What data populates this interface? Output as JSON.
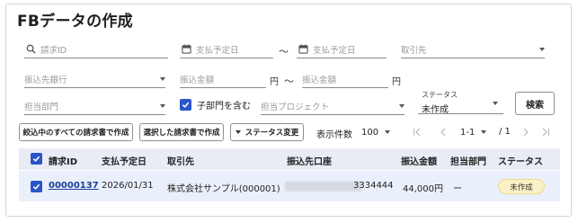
{
  "page_title": "FBデータの作成",
  "filters": {
    "invoice_id_placeholder": "請求ID",
    "pay_date_from_placeholder": "支払予定日",
    "range_sep": "〜",
    "pay_date_to_placeholder": "支払予定日",
    "client_placeholder": "取引先",
    "bank_placeholder": "振込先銀行",
    "amount_from_placeholder": "振込金額",
    "amount_unit": "円",
    "amount_to_placeholder": "振込金額",
    "dept_placeholder": "担当部門",
    "include_sub_label": "子部門を含む",
    "project_placeholder": "担当プロジェクト",
    "status_label": "ステータス",
    "status_value": "未作成",
    "search_button": "検索"
  },
  "actions": {
    "create_all": "絞込中のすべての請求書で作成",
    "create_selected": "選択した請求書で作成",
    "change_status": "ステータス変更"
  },
  "pager": {
    "per_page_label": "表示件数",
    "per_page_value": "100",
    "range_value": "1-1",
    "total": "/ 1"
  },
  "table": {
    "headers": {
      "invoice_id": "請求ID",
      "pay_date": "支払予定日",
      "client": "取引先",
      "account": "振込先口座",
      "amount": "振込金額",
      "dept": "担当部門",
      "status": "ステータス"
    },
    "rows": [
      {
        "invoice_id": "00000137",
        "pay_date": "2026/01/31",
        "client": "株式会社サンプル(000001)",
        "account_number": "3334444",
        "amount": "44,000円",
        "dept": "ー",
        "status": "未作成"
      }
    ]
  },
  "colors": {
    "accent": "#2a55c8",
    "header_bg": "#e9ecf5",
    "row_bg": "#eaf0fb",
    "badge_bg": "#fbf1c6"
  }
}
